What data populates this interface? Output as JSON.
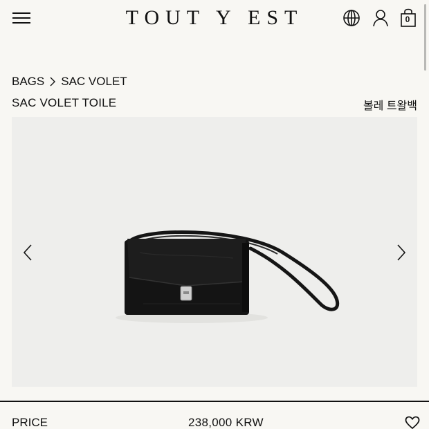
{
  "header": {
    "logo": "TOUT Y EST",
    "cart_count": "0"
  },
  "breadcrumb": {
    "category": "BAGS",
    "current": "SAC VOLET"
  },
  "product": {
    "title": "SAC VOLET TOILE",
    "title_kr": "볼레 트왈백",
    "price_label": "PRICE",
    "price": "238,000 KRW"
  },
  "icons": {
    "menu": "hamburger-menu-icon",
    "language": "globe-icon",
    "account": "user-icon",
    "cart": "shopping-bag-icon",
    "prev": "chevron-left-icon",
    "next": "chevron-right-icon",
    "wishlist": "heart-icon"
  },
  "colors": {
    "background": "#f8f7f3",
    "image_background": "#eeeeec",
    "text": "#111111"
  }
}
